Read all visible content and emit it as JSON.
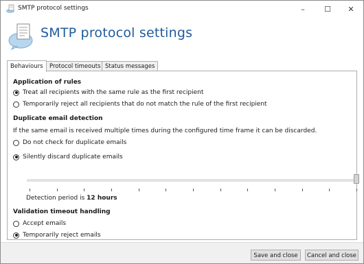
{
  "window": {
    "title": "SMTP protocol settings",
    "minimize_glyph": "–",
    "maximize_glyph": "☐",
    "close_glyph": "✕"
  },
  "header": {
    "title": "SMTP protocol settings",
    "icon": "document-bubble-icon"
  },
  "tabs": [
    {
      "label": "Behaviours",
      "active": true
    },
    {
      "label": "Protocol timeouts",
      "active": false
    },
    {
      "label": "Status messages",
      "active": false
    }
  ],
  "application_of_rules": {
    "title": "Application of rules",
    "options": [
      {
        "label": "Treat all recipients with the same rule as the first recipient",
        "checked": true
      },
      {
        "label": "Temporarily reject all recipients that do not match the rule of the first recipient",
        "checked": false
      }
    ]
  },
  "duplicate_detection": {
    "title": "Duplicate email detection",
    "description": "If the same email is received multiple times during the configured time frame it can be discarded.",
    "options": [
      {
        "label": "Do not check for duplicate emails",
        "checked": false
      },
      {
        "label": "Silently discard duplicate emails",
        "checked": true
      }
    ],
    "slider": {
      "tick_count": 13,
      "value_fraction": 1.0
    },
    "period_prefix": "Detection period is ",
    "period_value": "12 hours"
  },
  "validation_timeout": {
    "title": "Validation timeout handling",
    "options": [
      {
        "label": "Accept emails",
        "checked": false
      },
      {
        "label": "Temporarily reject emails",
        "checked": true
      }
    ]
  },
  "footer": {
    "save_label": "Save and close",
    "cancel_label": "Cancel and close"
  },
  "colors": {
    "header_title": "#1f5b9c",
    "footer_bg": "#f0f0f0",
    "button_bg": "#e1e1e1"
  }
}
